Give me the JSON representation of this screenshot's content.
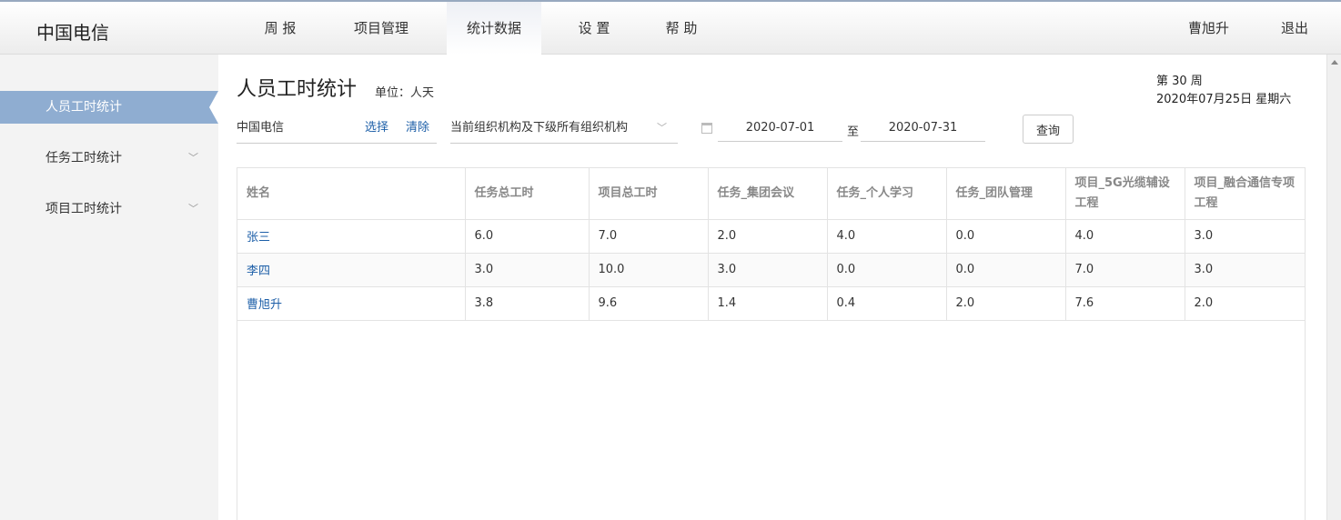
{
  "brand": "中国电信",
  "nav": {
    "items": [
      "周 报",
      "项目管理",
      "统计数据",
      "设 置",
      "帮 助"
    ],
    "active_index": 2,
    "user": "曹旭升",
    "logout": "退出"
  },
  "sidebar": {
    "items": [
      {
        "label": "人员工时统计",
        "active": true
      },
      {
        "label": "任务工时统计",
        "active": false
      },
      {
        "label": "项目工时统计",
        "active": false
      }
    ]
  },
  "page": {
    "title": "人员工时统计",
    "unit": "单位：人天",
    "week": "第 30 周",
    "date": "2020年07月25日 星期六"
  },
  "filters": {
    "org": "中国电信",
    "select_label": "选择",
    "clear_label": "清除",
    "scope": "当前组织机构及下级所有组织机构",
    "start_date": "2020-07-01",
    "to_label": "至",
    "end_date": "2020-07-31",
    "query_label": "查询"
  },
  "table": {
    "headers": [
      "姓名",
      "任务总工时",
      "项目总工时",
      "任务_集团会议",
      "任务_个人学习",
      "任务_团队管理",
      "项目_5G光缆辅设工程",
      "项目_融合通信专项工程"
    ],
    "rows": [
      [
        "张三",
        "6.0",
        "7.0",
        "2.0",
        "4.0",
        "0.0",
        "4.0",
        "3.0"
      ],
      [
        "李四",
        "3.0",
        "10.0",
        "3.0",
        "0.0",
        "0.0",
        "7.0",
        "3.0"
      ],
      [
        "曹旭升",
        "3.8",
        "9.6",
        "1.4",
        "0.4",
        "2.0",
        "7.6",
        "2.0"
      ]
    ]
  }
}
